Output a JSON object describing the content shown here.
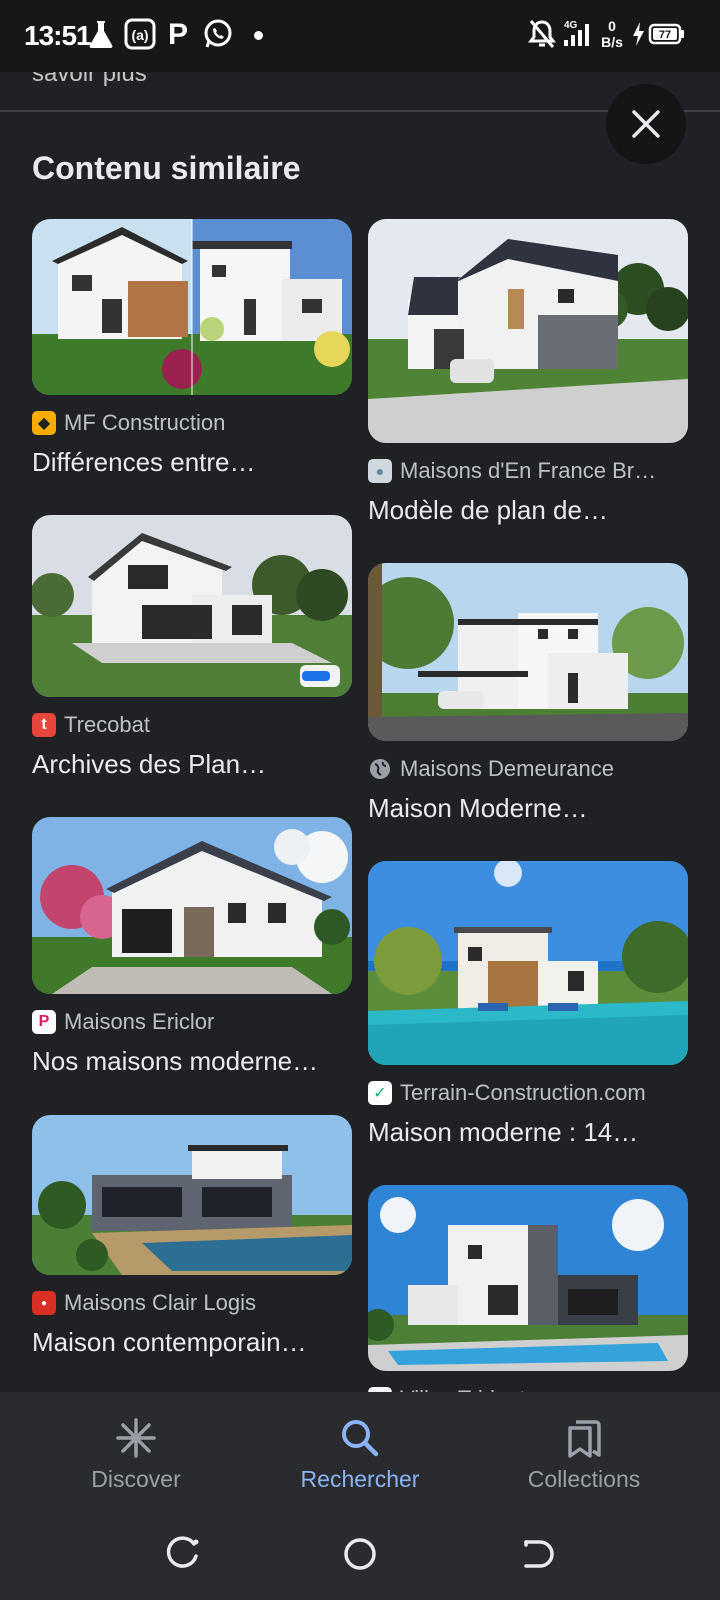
{
  "status_bar": {
    "time": "13:51",
    "net_speed": "0\nB/s",
    "battery": "77",
    "network": "4G",
    "icons": [
      "flask-icon",
      "app-icon",
      "parking-icon",
      "whatsapp-icon",
      "notification-dot",
      "mute-icon",
      "signal-icon",
      "charging-icon",
      "battery-icon"
    ]
  },
  "previous_content": {
    "text": "savoir plus"
  },
  "close_label": "Fermer",
  "section": {
    "title": "Contenu similaire"
  },
  "cards": [
    {
      "source": "MF Construction",
      "title": "Différences entre…",
      "favicon_color": "#f9ab00",
      "favicon_text": "◆"
    },
    {
      "source": "Maisons d'En France Br…",
      "title": "Modèle de plan de…",
      "favicon_color": "#cfd8dc",
      "favicon_text": "●"
    },
    {
      "source": "Trecobat",
      "title": "Archives des Plan…",
      "favicon_color": "#e8453c",
      "favicon_text": "t"
    },
    {
      "source": "Maisons Demeurance",
      "title": "Maison Moderne…",
      "favicon_color": "#5f6368",
      "favicon_text": "◍"
    },
    {
      "source": "Maisons Ericlor",
      "title": "Nos maisons moderne…",
      "favicon_color": "#e8175d",
      "favicon_text": "P"
    },
    {
      "source": "Terrain-Construction.com",
      "title": "Maison moderne : 14…",
      "favicon_color": "#0fb37a",
      "favicon_text": "✓"
    },
    {
      "source": "Maisons Clair Logis",
      "title": "Maison contemporain…",
      "favicon_color": "#d93025",
      "favicon_text": "●"
    },
    {
      "source": "Villas Trident",
      "title": "",
      "favicon_color": "#f4f4f4",
      "favicon_text": ""
    }
  ],
  "nav": {
    "items": [
      {
        "label": "Discover",
        "icon": "asterisk-icon"
      },
      {
        "label": "Rechercher",
        "icon": "search-icon",
        "active": true
      },
      {
        "label": "Collections",
        "icon": "collections-icon"
      }
    ],
    "active_color": "#8ab4f8"
  },
  "system_nav": [
    "recent-apps-button",
    "home-button",
    "back-button"
  ]
}
